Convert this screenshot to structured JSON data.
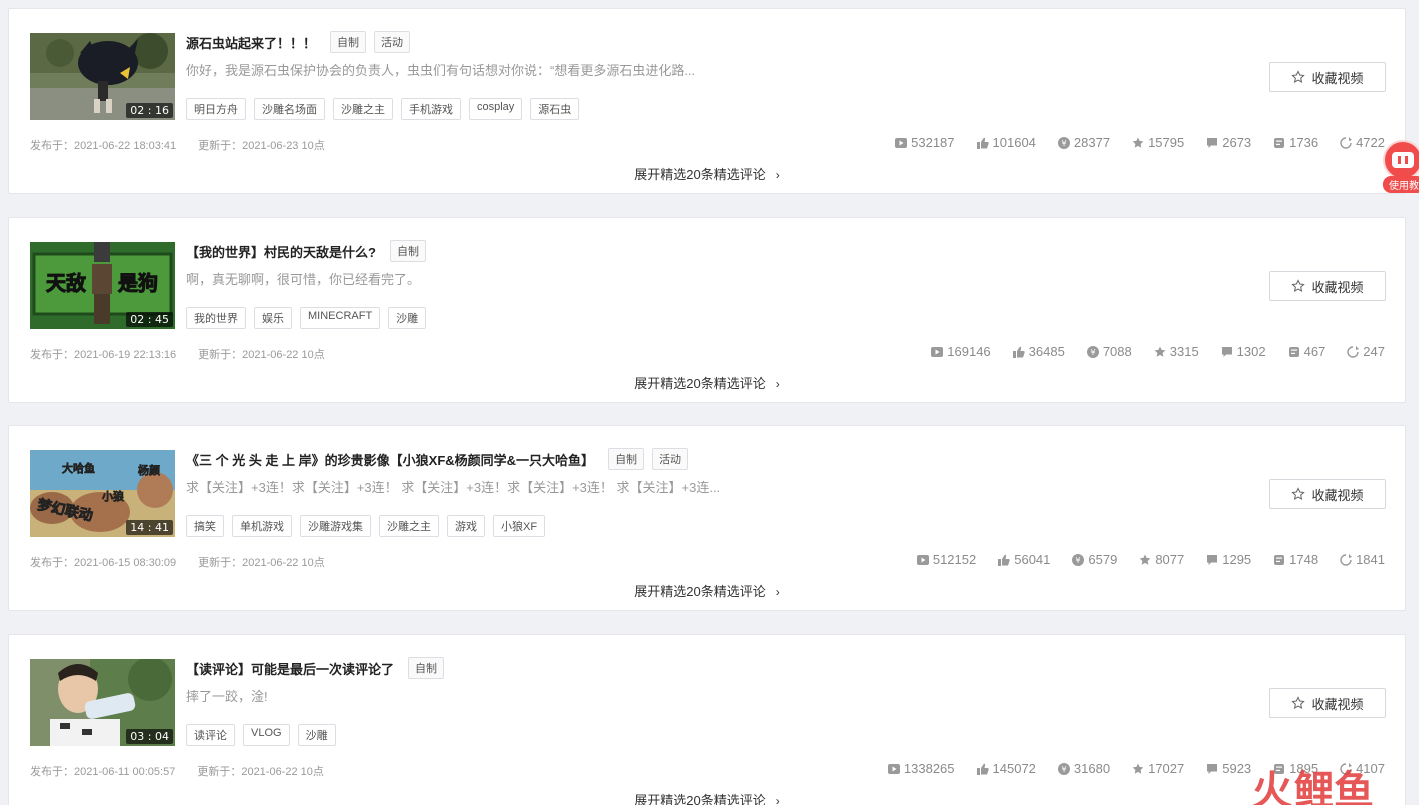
{
  "videos": [
    {
      "title": "源石虫站起来了！！！",
      "badges": [
        "自制",
        "活动"
      ],
      "description": "你好，我是源石虫保护协会的负责人，虫虫们有句话想对你说：“想看更多源石虫进化路...",
      "tags": [
        "明日方舟",
        "沙雕名场面",
        "沙雕之主",
        "手机游戏",
        "cosplay",
        "源石虫"
      ],
      "duration": "02 : 16",
      "published": "发布于：2021-06-22 18:03:41",
      "updated": "更新于：2021-06-23 10点",
      "favorite_label": "收藏视频",
      "stats": [
        "532187",
        "101604",
        "28377",
        "15795",
        "2673",
        "1736",
        "4722"
      ],
      "expand_label": "展开精选20条精选评论"
    },
    {
      "title": "【我的世界】村民的天敌是什么?",
      "badges": [
        "自制"
      ],
      "description": "啊，真无聊啊，很可惜，你已经看完了。",
      "tags": [
        "我的世界",
        "娱乐",
        "MINECRAFT",
        "沙雕"
      ],
      "duration": "02 : 45",
      "thumb_text_a": "天敌",
      "thumb_text_b": "是狗",
      "published": "发布于：2021-06-19 22:13:16",
      "updated": "更新于：2021-06-22 10点",
      "favorite_label": "收藏视频",
      "stats": [
        "169146",
        "36485",
        "7088",
        "3315",
        "1302",
        "467",
        "247"
      ],
      "expand_label": "展开精选20条精选评论"
    },
    {
      "title": "《三 个 光 头 走 上 岸》的珍贵影像【小狼XF&杨颜同学&一只大哈鱼】",
      "badges": [
        "自制",
        "活动"
      ],
      "description": "求【关注】+3连！求【关注】+3连！ 求【关注】+3连！求【关注】+3连！ 求【关注】+3连...",
      "tags": [
        "搞笑",
        "单机游戏",
        "沙雕游戏集",
        "沙雕之主",
        "游戏",
        "小狼XF"
      ],
      "duration": "14 : 41",
      "thumb_text_a": "大哈鱼",
      "thumb_text_b": "杨颜",
      "thumb_text_c": "小狼",
      "thumb_text_d": "梦幻联动",
      "published": "发布于：2021-06-15 08:30:09",
      "updated": "更新于：2021-06-22 10点",
      "favorite_label": "收藏视频",
      "stats": [
        "512152",
        "56041",
        "6579",
        "8077",
        "1295",
        "1748",
        "1841"
      ],
      "expand_label": "展开精选20条精选评论"
    },
    {
      "title": "【读评论】可能是最后一次读评论了",
      "badges": [
        "自制"
      ],
      "description": "摔了一跤，淦!",
      "tags": [
        "读评论",
        "VLOG",
        "沙雕"
      ],
      "duration": "03 : 04",
      "published": "发布于：2021-06-11 00:05:57",
      "updated": "更新于：2021-06-22 10点",
      "favorite_label": "收藏视频",
      "stats": [
        "1338265",
        "145072",
        "31680",
        "17027",
        "5923",
        "1895",
        "4107"
      ],
      "expand_label": "展开精选20条精选评论"
    }
  ],
  "stat_icons": [
    "play-icon",
    "like-icon",
    "coin-icon",
    "star-icon",
    "comment-icon",
    "danmaku-icon",
    "share-icon"
  ],
  "help": {
    "label": "使用教"
  },
  "watermark": {
    "a": "火",
    "b": "鲤鱼"
  },
  "colors": {
    "accent": "#f04c4c",
    "background": "#f0f1f5"
  }
}
